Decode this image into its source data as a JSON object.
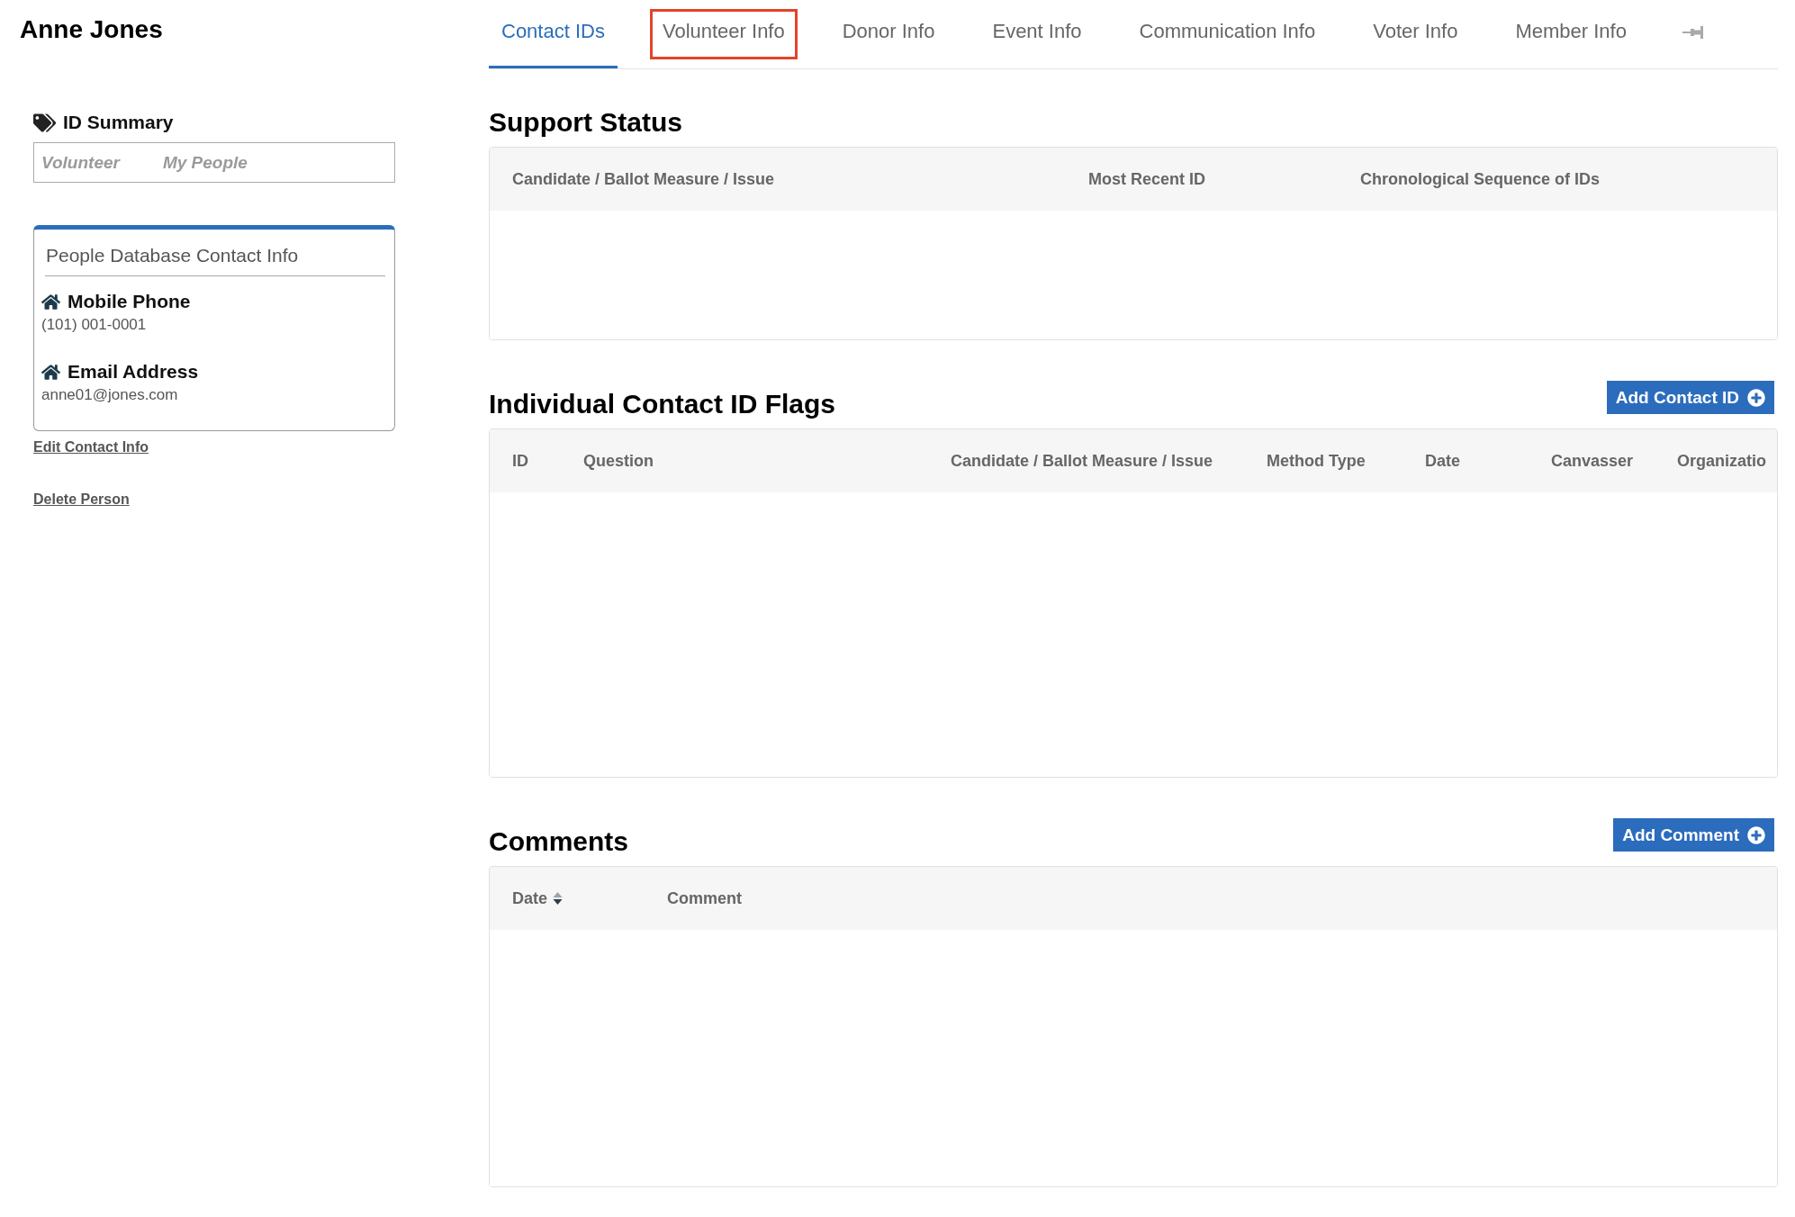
{
  "person": {
    "name": "Anne Jones"
  },
  "tabs": [
    {
      "label": "Contact IDs",
      "selected": true,
      "highlighted": false
    },
    {
      "label": "Volunteer Info",
      "selected": false,
      "highlighted": true
    },
    {
      "label": "Donor Info",
      "selected": false,
      "highlighted": false
    },
    {
      "label": "Event Info",
      "selected": false,
      "highlighted": false
    },
    {
      "label": "Communication Info",
      "selected": false,
      "highlighted": false
    },
    {
      "label": "Voter Info",
      "selected": false,
      "highlighted": false
    },
    {
      "label": "Member Info",
      "selected": false,
      "highlighted": false
    }
  ],
  "sidebar": {
    "id_summary": {
      "title": "ID Summary",
      "tags": [
        "Volunteer",
        "My People"
      ]
    },
    "contact_card": {
      "title": "People Database Contact Info",
      "entries": [
        {
          "label": "Mobile Phone",
          "value": "(101) 001-0001"
        },
        {
          "label": "Email Address",
          "value": "anne01@jones.com"
        }
      ]
    },
    "links": [
      "Edit Contact Info",
      "Delete Person"
    ]
  },
  "sections": [
    {
      "title": "Support Status",
      "columns": [
        {
          "label": "Candidate / Ballot Measure / Issue",
          "sortable": false
        },
        {
          "label": "Most Recent ID",
          "sortable": false
        },
        {
          "label": "Chronological Sequence of IDs",
          "sortable": false
        }
      ]
    },
    {
      "title": "Individual Contact ID Flags",
      "button": "Add Contact ID",
      "columns": [
        {
          "label": "ID",
          "sortable": false
        },
        {
          "label": "Question",
          "sortable": false
        },
        {
          "label": "Candidate / Ballot Measure / Issue",
          "sortable": false
        },
        {
          "label": "Method Type",
          "sortable": false
        },
        {
          "label": "Date",
          "sortable": false
        },
        {
          "label": "Canvasser",
          "sortable": false
        },
        {
          "label": "Organizatio",
          "sortable": false
        }
      ]
    },
    {
      "title": "Comments",
      "button": "Add Comment",
      "columns": [
        {
          "label": "Date",
          "sortable": true
        },
        {
          "label": "Comment",
          "sortable": false
        }
      ]
    }
  ]
}
